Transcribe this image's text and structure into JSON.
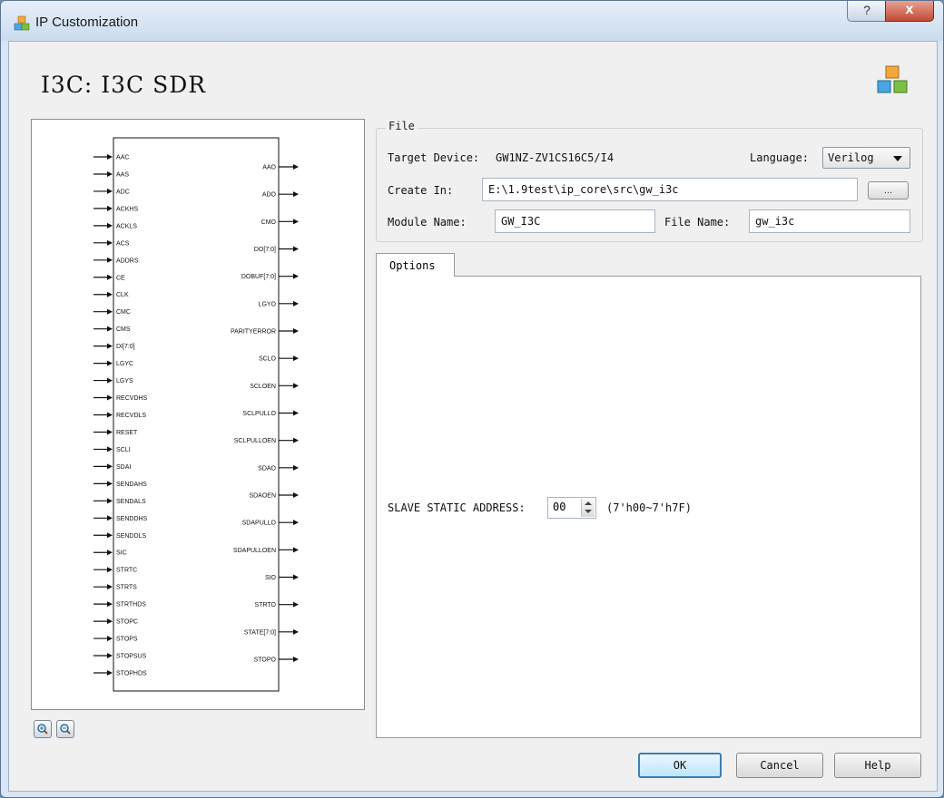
{
  "window": {
    "title": "IP Customization",
    "help_glyph": "?",
    "close_glyph": "x"
  },
  "header": {
    "title": "I3C: I3C SDR"
  },
  "schematic": {
    "inputs": [
      "AAC",
      "AAS",
      "ADC",
      "ACKHS",
      "ACKLS",
      "ACS",
      "ADDRS",
      "CE",
      "CLK",
      "CMC",
      "CMS",
      "DI[7:0]",
      "LGYC",
      "LGYS",
      "RECVDHS",
      "RECVDLS",
      "RESET",
      "SCLI",
      "SDAI",
      "SENDAHS",
      "SENDALS",
      "SENDDHS",
      "SENDDLS",
      "SIC",
      "STRTC",
      "STRTS",
      "STRTHDS",
      "STOPC",
      "STOPS",
      "STOPSUS",
      "STOPHDS"
    ],
    "outputs": [
      "AAO",
      "ADO",
      "CMO",
      "DO[7:0]",
      "DOBUF[7:0]",
      "LGYO",
      "PARITYERROR",
      "SCLO",
      "SCLOEN",
      "SCLPULLO",
      "SCLPULLOEN",
      "SDAO",
      "SDAOEN",
      "SDAPULLO",
      "SDAPULLOEN",
      "SIO",
      "STRTO",
      "STATE[7:0]",
      "STOPO"
    ]
  },
  "zoom": {
    "in_icon": "zoom-in-icon",
    "out_icon": "zoom-out-icon"
  },
  "file": {
    "group_label": "File",
    "target_device_label": "Target Device:",
    "target_device_value": "GW1NZ-ZV1CS16C5/I4",
    "language_label": "Language:",
    "language_value": "Verilog",
    "create_in_label": "Create In:",
    "create_in_value": "E:\\1.9test\\ip_core\\src\\gw_i3c",
    "browse_label": "...",
    "module_name_label": "Module Name:",
    "module_name_value": "GW_I3C",
    "file_name_label": "File Name:",
    "file_name_value": "gw_i3c"
  },
  "options": {
    "tab_label": "Options",
    "slave_addr_label": "SLAVE STATIC ADDRESS:",
    "slave_addr_value": "00",
    "slave_addr_range": "(7'h00~7'h7F)"
  },
  "buttons": {
    "ok": "OK",
    "cancel": "Cancel",
    "help": "Help"
  },
  "colors": {
    "title_bar": "#cbdcee",
    "close_button": "#c34a35",
    "ok_border": "#3c7fb1"
  }
}
